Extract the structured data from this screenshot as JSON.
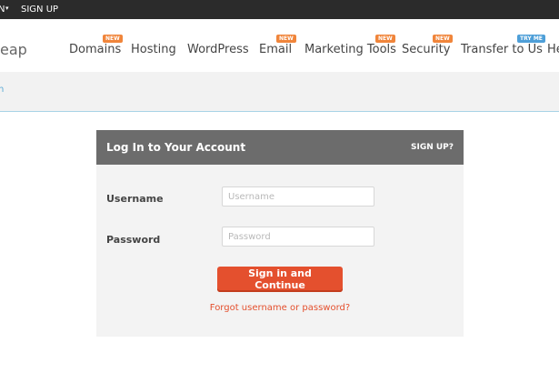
{
  "topbar": {
    "login_label": "N",
    "caret": "▾",
    "signup_label": "SIGN UP"
  },
  "brand": {
    "text": "eap"
  },
  "nav": {
    "items": [
      {
        "label": "Domains",
        "badge": "NEW"
      },
      {
        "label": "Hosting",
        "badge": ""
      },
      {
        "label": "WordPress",
        "badge": ""
      },
      {
        "label": "Email",
        "badge": "NEW"
      },
      {
        "label": "Marketing Tools",
        "badge": "NEW"
      },
      {
        "label": "Security",
        "badge": "NEW"
      },
      {
        "label": "Transfer to Us",
        "badge": "TRY ME"
      },
      {
        "label": "He",
        "badge": ""
      }
    ]
  },
  "subbar": {
    "crumb": "n"
  },
  "login": {
    "title": "Log In to Your Account",
    "signup_link": "SIGN UP?",
    "username_label": "Username",
    "username_placeholder": "Username",
    "password_label": "Password",
    "password_placeholder": "Password",
    "submit_label": "Sign in and Continue",
    "forgot_link": "Forgot username or password?"
  },
  "colors": {
    "topbar_bg": "#2b2b2b",
    "accent_orange": "#e4502e",
    "badge_new": "#f0853b",
    "badge_try": "#4e9fd8",
    "panel_header": "#6c6c6c"
  }
}
